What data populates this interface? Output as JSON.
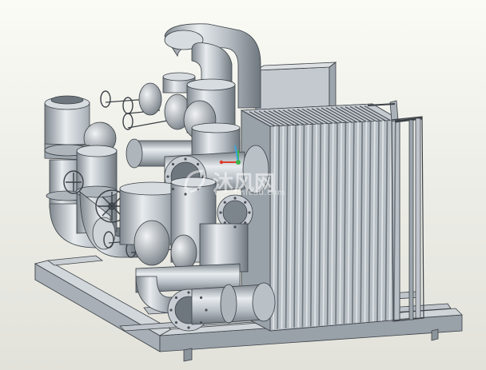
{
  "viewport": {
    "background_top": "#fbfbf6",
    "background_bottom": "#e2e2db"
  },
  "model": {
    "part_color": "#b5bcc2",
    "shadow_color": "#7e868d",
    "highlight_color": "#e6eaee",
    "edge_color": "#3a4045"
  },
  "csys": {
    "x_color": "#e03a2f",
    "y_color": "#38b44a",
    "z_color": "#3aa6e0"
  },
  "watermark": {
    "text": "沐风网",
    "subtext": "www.mfcad.com",
    "icon": "mfcad-logo-icon"
  }
}
